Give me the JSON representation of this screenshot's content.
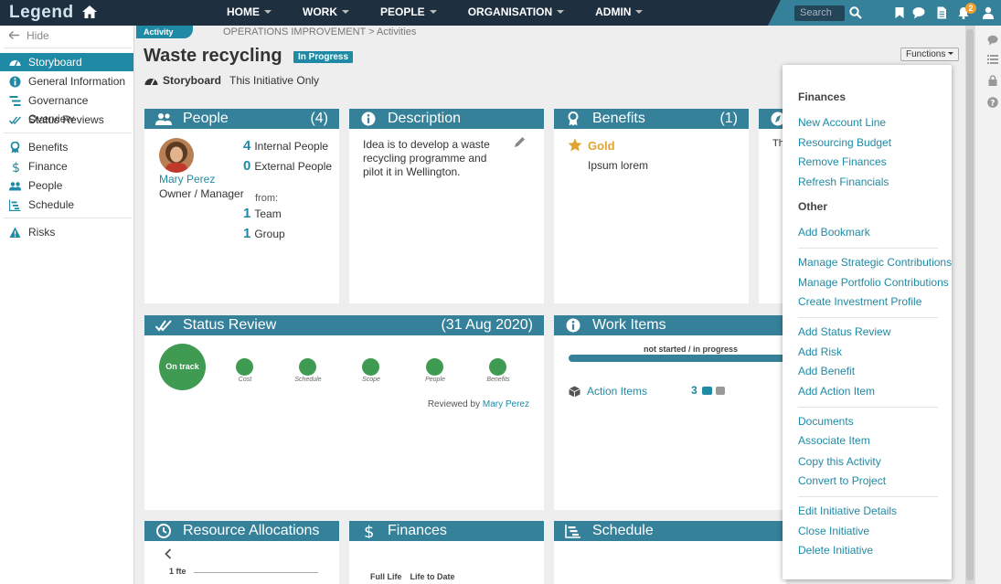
{
  "app": {
    "logo": "Legend"
  },
  "nav": {
    "items": [
      {
        "label": "HOME"
      },
      {
        "label": "WORK"
      },
      {
        "label": "PEOPLE"
      },
      {
        "label": "ORGANISATION"
      },
      {
        "label": "ADMIN"
      }
    ],
    "search_placeholder": "Search",
    "notification_count": "2"
  },
  "sidebar": {
    "hide_label": "Hide",
    "items": [
      {
        "label": "Storyboard",
        "icon": "dashboard-icon",
        "active": true
      },
      {
        "label": "General Information",
        "icon": "info-icon"
      },
      {
        "label": "Governance Overview",
        "icon": "governance-icon"
      },
      {
        "label": "Status Reviews",
        "icon": "check-double-icon"
      },
      {
        "label": "Benefits",
        "icon": "ribbon-icon"
      },
      {
        "label": "Finance",
        "icon": "dollar-icon"
      },
      {
        "label": "People",
        "icon": "people-icon"
      },
      {
        "label": "Schedule",
        "icon": "schedule-icon"
      },
      {
        "label": "Risks",
        "icon": "warning-icon"
      }
    ]
  },
  "page": {
    "tab_label": "Activity",
    "breadcrumb": "OPERATIONS IMPROVEMENT > Activities",
    "title": "Waste recycling",
    "status": "In Progress",
    "storyboard_label": "Storyboard",
    "storyboard_scope": "This Initiative Only",
    "functions_label": "Functions"
  },
  "people": {
    "title": "People",
    "count": "(4)",
    "person_name": "Mary Perez",
    "person_role": "Owner / Manager",
    "internal_n": "4",
    "internal_label": "Internal People",
    "external_n": "0",
    "external_label": "External People",
    "from_label": "from:",
    "team_n": "1",
    "team_label": "Team",
    "group_n": "1",
    "group_label": "Group"
  },
  "description": {
    "title": "Description",
    "text": "Idea is to develop a waste recycling programme and pilot it in Wellington."
  },
  "benefits": {
    "title": "Benefits",
    "count": "(1)",
    "level": "Gold",
    "item": "Ipsum lorem"
  },
  "hidden_card": {
    "snippet": "Th"
  },
  "status_review": {
    "title": "Status Review",
    "date": "(31 Aug 2020)",
    "overall": "On track",
    "dimensions": [
      "Cost",
      "Schedule",
      "Scope",
      "People",
      "Benefits"
    ],
    "reviewed_by_label": "Reviewed by",
    "reviewer": "Mary Perez",
    "colors": {
      "on_track": "#3f9a52"
    }
  },
  "work_items": {
    "title": "Work Items",
    "bar_label": "not started / in progress",
    "item_label": "Action Items",
    "item_count": "3"
  },
  "resource_allocations": {
    "title": "Resource Allocations",
    "axis_label": "1 fte"
  },
  "finances": {
    "title": "Finances",
    "col1": "Full Life",
    "col2": "Life to Date"
  },
  "schedule": {
    "title": "Schedule"
  },
  "functions_menu": {
    "finances_heading": "Finances",
    "finances_items": [
      "New Account Line",
      "Resourcing Budget",
      "Remove Finances",
      "Refresh Financials"
    ],
    "other_heading": "Other",
    "group1": [
      "Add Bookmark"
    ],
    "group2": [
      "Manage Strategic Contributions",
      "Manage Portfolio Contributions",
      "Create Investment Profile"
    ],
    "group3": [
      "Add Status Review",
      "Add Risk",
      "Add Benefit",
      "Add Action Item"
    ],
    "group4": [
      "Documents",
      "Associate Item",
      "Copy this Activity",
      "Convert to Project"
    ],
    "group5": [
      "Edit Initiative Details",
      "Close Initiative",
      "Delete Initiative"
    ]
  },
  "theme": {
    "accent": "#1f8aa5",
    "header": "#35819a",
    "nav_bg": "#1e2f40",
    "gold": "#e0a431"
  }
}
